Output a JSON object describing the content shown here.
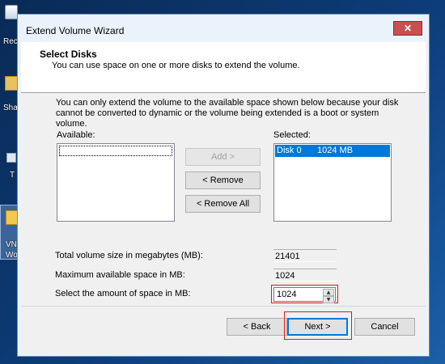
{
  "desktop": {
    "icons": [
      {
        "label": "Rec",
        "icon": "recycle-bin-icon"
      },
      {
        "label": "Sha",
        "icon": "folder-icon"
      },
      {
        "label": "T",
        "icon": "file-icon"
      },
      {
        "label": "VN\nWor",
        "icon": "folder-icon"
      }
    ]
  },
  "window": {
    "title": "Extend Volume Wizard",
    "close_label": "✕"
  },
  "header": {
    "title": "Select Disks",
    "subtitle": "You can use space on one or more disks to extend the volume."
  },
  "body": {
    "description": "You can only extend the volume to the available space shown below because your disk cannot be converted to dynamic or the volume being extended is a boot or system volume.",
    "available_label": "Available:",
    "selected_label": "Selected:",
    "selected_items": [
      {
        "disk": "Disk 0",
        "size": "1024 MB"
      }
    ],
    "add_label": "Add >",
    "remove_label": "< Remove",
    "remove_all_label": "< Remove All",
    "total_label": "Total volume size in megabytes (MB):",
    "total_value": "21401",
    "max_label": "Maximum available space in MB:",
    "max_value": "1024",
    "amount_label": "Select the amount of space in MB:",
    "amount_value": "1024"
  },
  "footer": {
    "back_label": "< Back",
    "next_label": "Next >",
    "cancel_label": "Cancel"
  },
  "colors": {
    "accent": "#0078d7",
    "highlight_box": "#e01a1a",
    "title_bg": "#eaf3fc",
    "close_bg": "#c75050"
  }
}
